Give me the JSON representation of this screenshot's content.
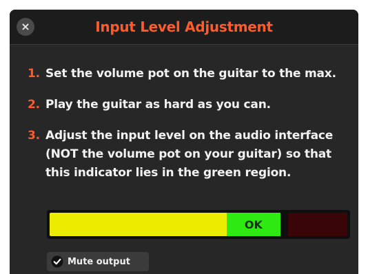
{
  "dialog": {
    "close_label": "×",
    "title": "Input Level Adjustment",
    "accent_color": "#ff5a2a"
  },
  "steps": [
    {
      "number": "1.",
      "text": "Set the volume pot on the guitar to the max."
    },
    {
      "number": "2.",
      "text": "Play the guitar as hard as you can."
    },
    {
      "number": "3.",
      "text": "Adjust the input level on the audio interface (NOT the volume pot on your guitar) so that this indicator lies in the green region."
    }
  ],
  "level_meter": {
    "ok_label": "OK",
    "zones": [
      {
        "name": "yellow",
        "color": "#ecec00",
        "fraction": 0.595
      },
      {
        "name": "green",
        "color": "#2eea12",
        "fraction": 0.18
      },
      {
        "name": "gap",
        "color": "#0e0e0e",
        "fraction": 0.025
      },
      {
        "name": "red",
        "color": "#3a0506",
        "fraction": 0.2
      }
    ]
  },
  "mute_output": {
    "label": "Mute output",
    "checked": true,
    "icon": "check-circle-icon"
  }
}
